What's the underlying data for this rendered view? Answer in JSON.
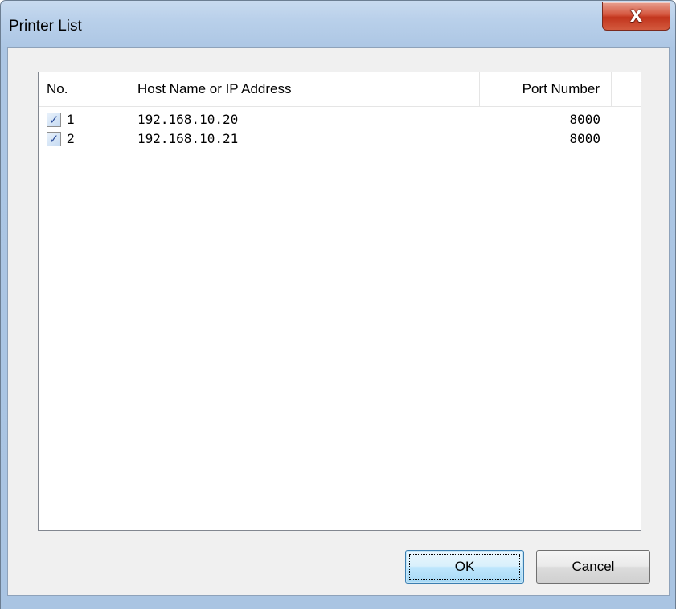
{
  "window": {
    "title": "Printer List",
    "close_glyph": "X"
  },
  "list": {
    "columns": [
      "No.",
      "Host Name or IP Address",
      "Port Number"
    ],
    "rows": [
      {
        "checked": true,
        "no": "1",
        "host": "192.168.10.20",
        "port": "8000"
      },
      {
        "checked": true,
        "no": "2",
        "host": "192.168.10.21",
        "port": "8000"
      }
    ],
    "check_glyph": "✓"
  },
  "buttons": {
    "ok": "OK",
    "cancel": "Cancel"
  },
  "colors": {
    "title_bar": "#b9d0ea",
    "close_button": "#c2351d",
    "client_bg": "#f0f0f0",
    "default_button": "#bee6fd"
  },
  "icons": {
    "close": "close-icon",
    "check": "checkmark-icon"
  }
}
